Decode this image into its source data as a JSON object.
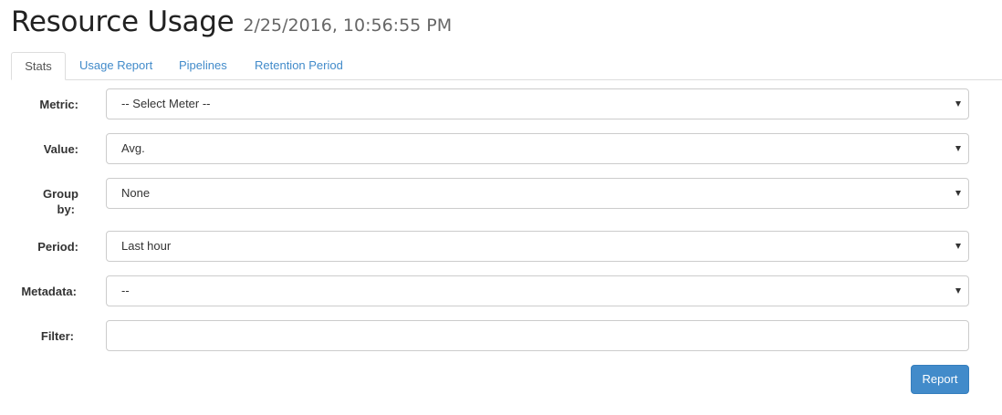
{
  "header": {
    "title": "Resource Usage",
    "timestamp": "2/25/2016, 10:56:55 PM"
  },
  "tabs": [
    {
      "label": "Stats",
      "active": true
    },
    {
      "label": "Usage Report",
      "active": false
    },
    {
      "label": "Pipelines",
      "active": false
    },
    {
      "label": "Retention Period",
      "active": false
    }
  ],
  "form": {
    "metric": {
      "label": "Metric:",
      "value": "-- Select Meter --"
    },
    "value": {
      "label": "Value:",
      "value": "Avg."
    },
    "group_by": {
      "label_line1": "Group",
      "label_line2": "by:",
      "value": "None"
    },
    "period": {
      "label": "Period:",
      "value": "Last hour"
    },
    "metadata": {
      "label": "Metadata:",
      "value": "--"
    },
    "filter": {
      "label": "Filter:",
      "value": ""
    }
  },
  "actions": {
    "report_label": "Report"
  },
  "colors": {
    "accent": "#428bca",
    "border": "#cccccc"
  }
}
